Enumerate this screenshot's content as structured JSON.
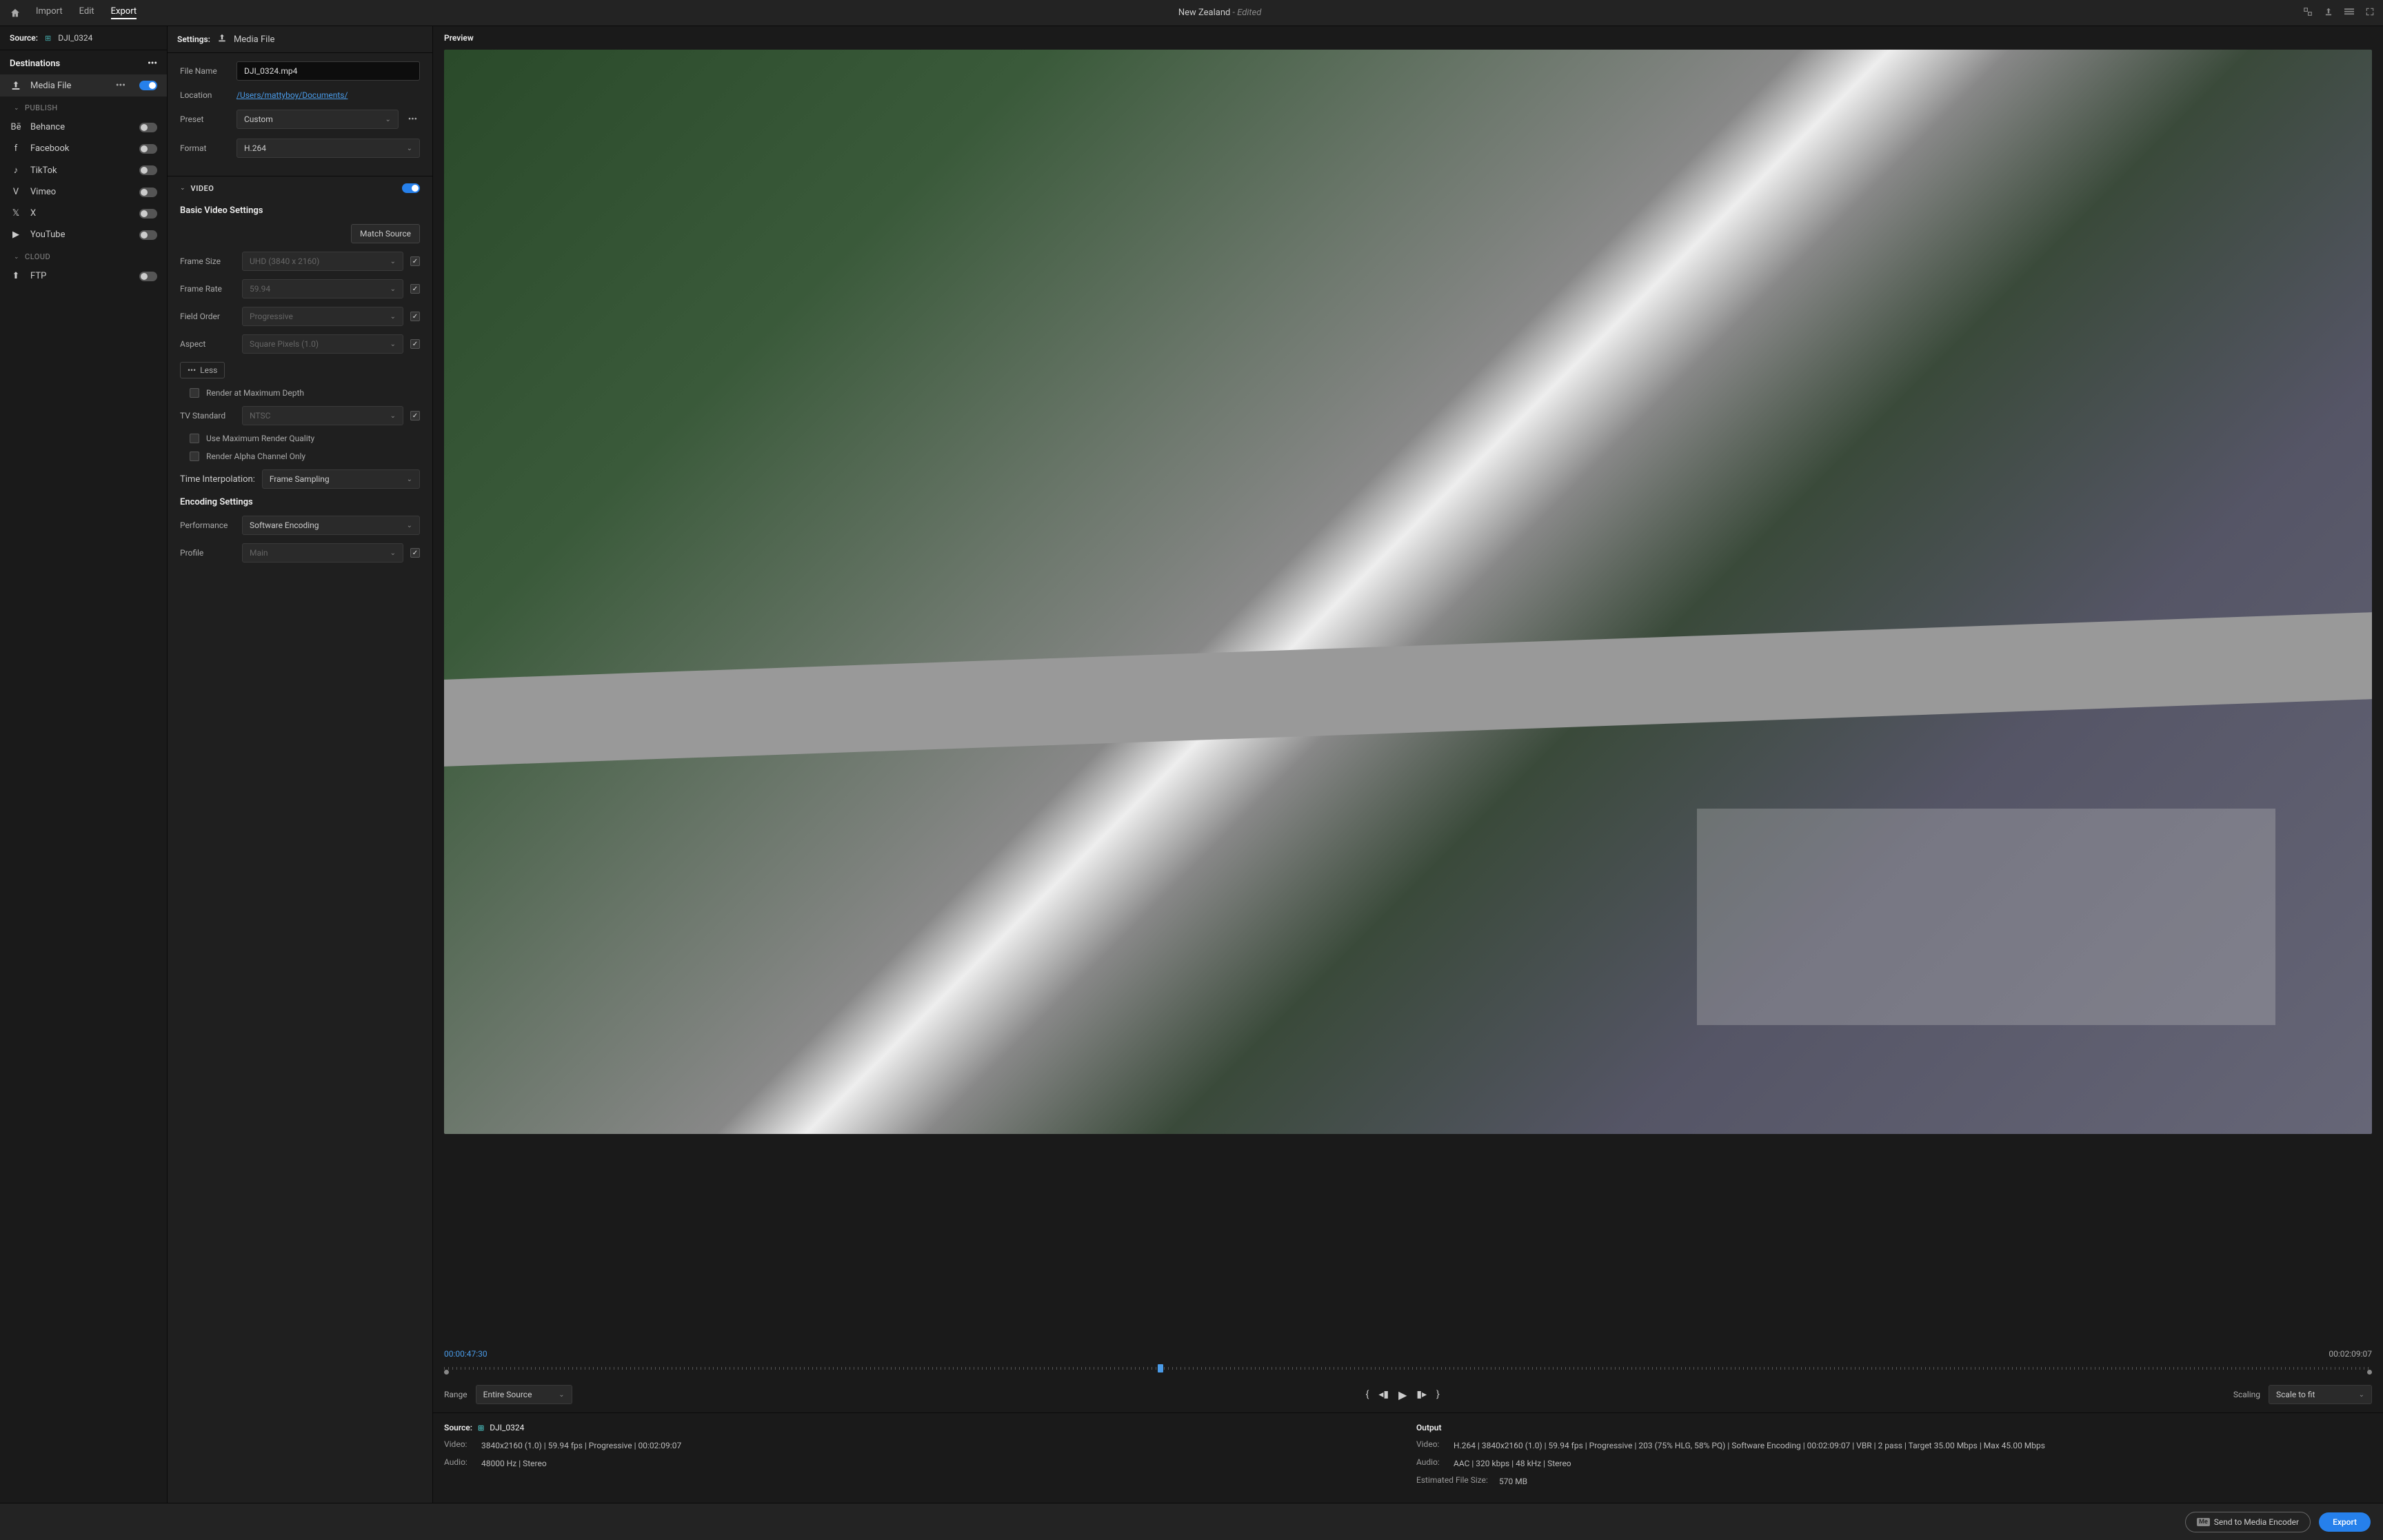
{
  "topbar": {
    "tabs": {
      "import": "Import",
      "edit": "Edit",
      "export": "Export"
    },
    "title": "New Zealand",
    "title_suffix": " - Edited"
  },
  "source": {
    "label": "Source:",
    "name": "DJI_0324"
  },
  "destinations": {
    "header": "Destinations",
    "media_file": "Media File",
    "publish_group": "PUBLISH",
    "cloud_group": "CLOUD",
    "publish": [
      {
        "name": "Behance",
        "icon": "Bē"
      },
      {
        "name": "Facebook",
        "icon": "f"
      },
      {
        "name": "TikTok",
        "icon": "♪"
      },
      {
        "name": "Vimeo",
        "icon": "V"
      },
      {
        "name": "X",
        "icon": "𝕏"
      },
      {
        "name": "YouTube",
        "icon": "▶"
      }
    ],
    "cloud": [
      {
        "name": "FTP",
        "icon": "⬆"
      }
    ]
  },
  "settings": {
    "header_label": "Settings:",
    "header_name": "Media File",
    "file_name_label": "File Name",
    "file_name_value": "DJI_0324.mp4",
    "location_label": "Location",
    "location_value": "/Users/mattyboy/Documents/",
    "preset_label": "Preset",
    "preset_value": "Custom",
    "format_label": "Format",
    "format_value": "H.264"
  },
  "video": {
    "section_title": "VIDEO",
    "basic_title": "Basic Video Settings",
    "match_source": "Match Source",
    "frame_size_label": "Frame Size",
    "frame_size_value": "UHD (3840 x 2160)",
    "frame_rate_label": "Frame Rate",
    "frame_rate_value": "59.94",
    "field_order_label": "Field Order",
    "field_order_value": "Progressive",
    "aspect_label": "Aspect",
    "aspect_value": "Square Pixels (1.0)",
    "less_button": "Less",
    "render_max_depth": "Render at Maximum Depth",
    "tv_standard_label": "TV Standard",
    "tv_standard_value": "NTSC",
    "use_max_quality": "Use Maximum Render Quality",
    "render_alpha": "Render Alpha Channel Only",
    "time_interp_label": "Time Interpolation:",
    "time_interp_value": "Frame Sampling",
    "encoding_title": "Encoding Settings",
    "performance_label": "Performance",
    "performance_value": "Software Encoding",
    "profile_label": "Profile",
    "profile_value": "Main"
  },
  "preview": {
    "header": "Preview",
    "time_current": "00:00:47:30",
    "time_duration": "00:02:09:07",
    "range_label": "Range",
    "range_value": "Entire Source",
    "scaling_label": "Scaling",
    "scaling_value": "Scale to fit"
  },
  "info": {
    "source_label": "Source:",
    "source_name": "DJI_0324",
    "src_video_key": "Video:",
    "src_video_val": "3840x2160 (1.0) | 59.94 fps | Progressive | 00:02:09:07",
    "src_audio_key": "Audio:",
    "src_audio_val": "48000 Hz | Stereo",
    "output_label": "Output",
    "out_video_key": "Video:",
    "out_video_val": "H.264 | 3840x2160 (1.0) | 59.94 fps | Progressive | 203 (75% HLG, 58% PQ) | Software Encoding | 00:02:09:07 | VBR | 2 pass | Target 35.00 Mbps | Max 45.00 Mbps",
    "out_audio_key": "Audio:",
    "out_audio_val": "AAC | 320 kbps | 48 kHz | Stereo",
    "est_size_key": "Estimated File Size:",
    "est_size_val": "570 MB"
  },
  "footer": {
    "send_to_me": "Send to Media Encoder",
    "export": "Export"
  }
}
